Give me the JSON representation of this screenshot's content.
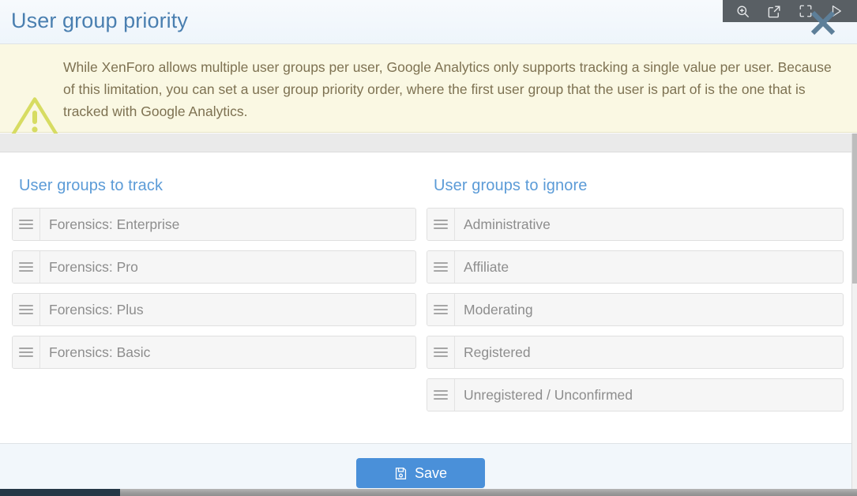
{
  "header": {
    "title": "User group priority"
  },
  "overlay_toolbar": {
    "icons": [
      {
        "name": "zoom-in-icon",
        "label": "Zoom in"
      },
      {
        "name": "open-in-new-icon",
        "label": "Open in new window"
      },
      {
        "name": "fullscreen-icon",
        "label": "Fullscreen"
      },
      {
        "name": "play-icon",
        "label": "Play"
      }
    ],
    "close_label": "Close"
  },
  "notice": {
    "icon": "warning-triangle-icon",
    "text": "While XenForo allows multiple user groups per user, Google Analytics only supports tracking a single value per user. Because of this limitation, you can set a user group priority order, where the first user group that the user is part of is the one that is tracked with Google Analytics."
  },
  "columns": [
    {
      "key": "track",
      "heading": "User groups to track",
      "items": [
        "Forensics: Enterprise",
        "Forensics: Pro",
        "Forensics: Plus",
        "Forensics: Basic"
      ]
    },
    {
      "key": "ignore",
      "heading": "User groups to ignore",
      "items": [
        "Administrative",
        "Affiliate",
        "Moderating",
        "Registered",
        "Unregistered / Unconfirmed"
      ]
    }
  ],
  "footer": {
    "save_label": "Save",
    "save_icon": "floppy-disk-icon"
  },
  "colors": {
    "title_blue": "#4a7fb0",
    "heading_blue": "#5b9bd7",
    "notice_bg": "#faf8e3",
    "notice_text": "#7e7252",
    "warning_icon": "#d7dc62",
    "row_bg": "#f6f6f6",
    "row_text": "#8d8d8d",
    "save_button": "#4a90d9",
    "toolbar_bg": "#595f64",
    "scrollbar_thumb": "#253746"
  }
}
